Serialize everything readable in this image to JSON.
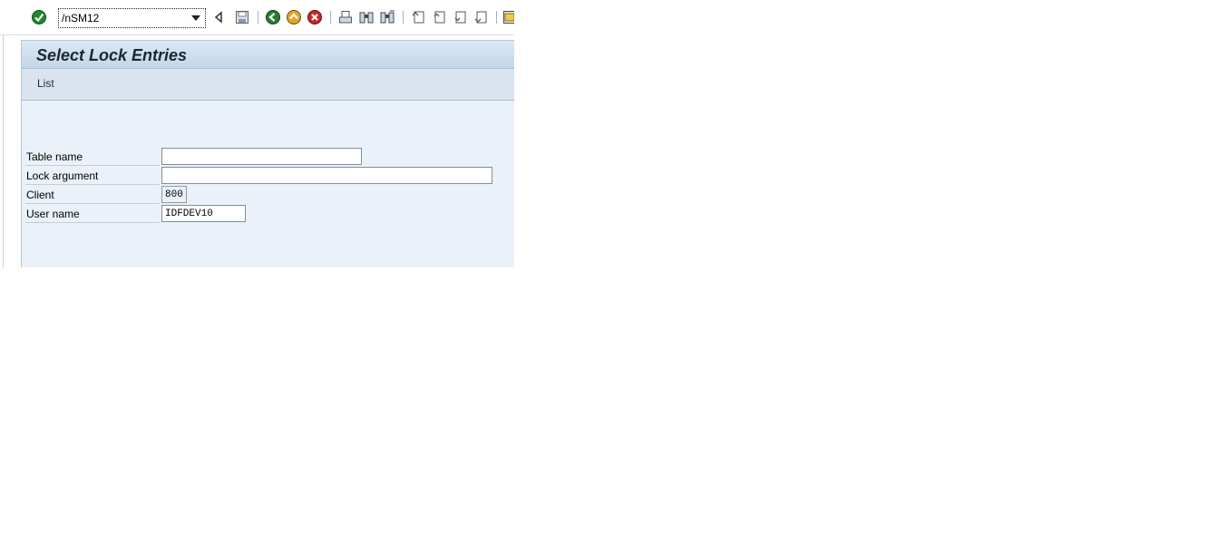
{
  "toolbar": {
    "command_field": {
      "value": "/nSM12"
    },
    "colors": {
      "enter_green": "#1f8a2b",
      "back_green": "#2a7d2e",
      "exit_yellow": "#e2a52a",
      "cancel_red": "#c62828"
    }
  },
  "page": {
    "title": "Select Lock Entries",
    "menu": {
      "list_label": "List"
    }
  },
  "form": {
    "table_name": {
      "label": "Table name",
      "value": ""
    },
    "lock_argument": {
      "label": "Lock argument",
      "value": ""
    },
    "client": {
      "label": "Client",
      "value": "800"
    },
    "user_name": {
      "label": "User name",
      "value": "IDFDEV10"
    }
  }
}
